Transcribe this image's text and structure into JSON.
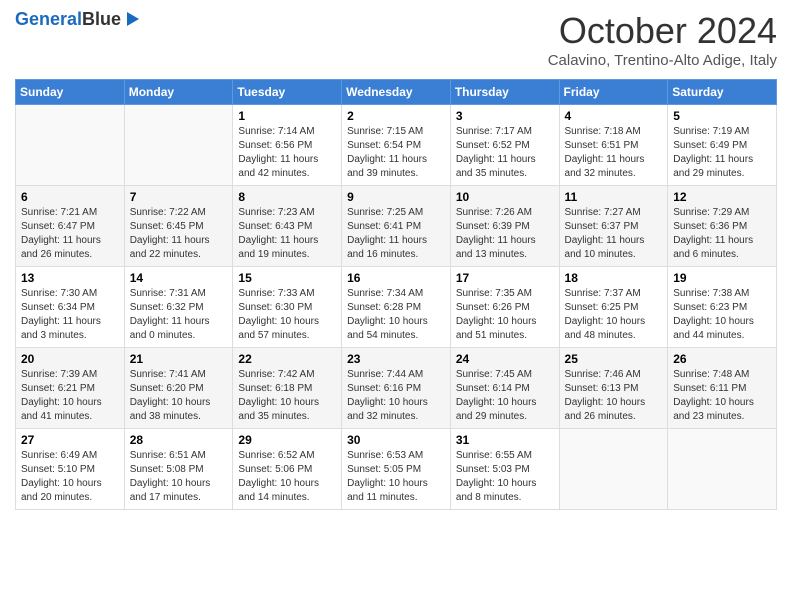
{
  "header": {
    "logo_line1": "General",
    "logo_line2": "Blue",
    "month": "October 2024",
    "location": "Calavino, Trentino-Alto Adige, Italy"
  },
  "days_of_week": [
    "Sunday",
    "Monday",
    "Tuesday",
    "Wednesday",
    "Thursday",
    "Friday",
    "Saturday"
  ],
  "weeks": [
    [
      {
        "day": "",
        "sunrise": "",
        "sunset": "",
        "daylight": ""
      },
      {
        "day": "",
        "sunrise": "",
        "sunset": "",
        "daylight": ""
      },
      {
        "day": "1",
        "sunrise": "Sunrise: 7:14 AM",
        "sunset": "Sunset: 6:56 PM",
        "daylight": "Daylight: 11 hours and 42 minutes."
      },
      {
        "day": "2",
        "sunrise": "Sunrise: 7:15 AM",
        "sunset": "Sunset: 6:54 PM",
        "daylight": "Daylight: 11 hours and 39 minutes."
      },
      {
        "day": "3",
        "sunrise": "Sunrise: 7:17 AM",
        "sunset": "Sunset: 6:52 PM",
        "daylight": "Daylight: 11 hours and 35 minutes."
      },
      {
        "day": "4",
        "sunrise": "Sunrise: 7:18 AM",
        "sunset": "Sunset: 6:51 PM",
        "daylight": "Daylight: 11 hours and 32 minutes."
      },
      {
        "day": "5",
        "sunrise": "Sunrise: 7:19 AM",
        "sunset": "Sunset: 6:49 PM",
        "daylight": "Daylight: 11 hours and 29 minutes."
      }
    ],
    [
      {
        "day": "6",
        "sunrise": "Sunrise: 7:21 AM",
        "sunset": "Sunset: 6:47 PM",
        "daylight": "Daylight: 11 hours and 26 minutes."
      },
      {
        "day": "7",
        "sunrise": "Sunrise: 7:22 AM",
        "sunset": "Sunset: 6:45 PM",
        "daylight": "Daylight: 11 hours and 22 minutes."
      },
      {
        "day": "8",
        "sunrise": "Sunrise: 7:23 AM",
        "sunset": "Sunset: 6:43 PM",
        "daylight": "Daylight: 11 hours and 19 minutes."
      },
      {
        "day": "9",
        "sunrise": "Sunrise: 7:25 AM",
        "sunset": "Sunset: 6:41 PM",
        "daylight": "Daylight: 11 hours and 16 minutes."
      },
      {
        "day": "10",
        "sunrise": "Sunrise: 7:26 AM",
        "sunset": "Sunset: 6:39 PM",
        "daylight": "Daylight: 11 hours and 13 minutes."
      },
      {
        "day": "11",
        "sunrise": "Sunrise: 7:27 AM",
        "sunset": "Sunset: 6:37 PM",
        "daylight": "Daylight: 11 hours and 10 minutes."
      },
      {
        "day": "12",
        "sunrise": "Sunrise: 7:29 AM",
        "sunset": "Sunset: 6:36 PM",
        "daylight": "Daylight: 11 hours and 6 minutes."
      }
    ],
    [
      {
        "day": "13",
        "sunrise": "Sunrise: 7:30 AM",
        "sunset": "Sunset: 6:34 PM",
        "daylight": "Daylight: 11 hours and 3 minutes."
      },
      {
        "day": "14",
        "sunrise": "Sunrise: 7:31 AM",
        "sunset": "Sunset: 6:32 PM",
        "daylight": "Daylight: 11 hours and 0 minutes."
      },
      {
        "day": "15",
        "sunrise": "Sunrise: 7:33 AM",
        "sunset": "Sunset: 6:30 PM",
        "daylight": "Daylight: 10 hours and 57 minutes."
      },
      {
        "day": "16",
        "sunrise": "Sunrise: 7:34 AM",
        "sunset": "Sunset: 6:28 PM",
        "daylight": "Daylight: 10 hours and 54 minutes."
      },
      {
        "day": "17",
        "sunrise": "Sunrise: 7:35 AM",
        "sunset": "Sunset: 6:26 PM",
        "daylight": "Daylight: 10 hours and 51 minutes."
      },
      {
        "day": "18",
        "sunrise": "Sunrise: 7:37 AM",
        "sunset": "Sunset: 6:25 PM",
        "daylight": "Daylight: 10 hours and 48 minutes."
      },
      {
        "day": "19",
        "sunrise": "Sunrise: 7:38 AM",
        "sunset": "Sunset: 6:23 PM",
        "daylight": "Daylight: 10 hours and 44 minutes."
      }
    ],
    [
      {
        "day": "20",
        "sunrise": "Sunrise: 7:39 AM",
        "sunset": "Sunset: 6:21 PM",
        "daylight": "Daylight: 10 hours and 41 minutes."
      },
      {
        "day": "21",
        "sunrise": "Sunrise: 7:41 AM",
        "sunset": "Sunset: 6:20 PM",
        "daylight": "Daylight: 10 hours and 38 minutes."
      },
      {
        "day": "22",
        "sunrise": "Sunrise: 7:42 AM",
        "sunset": "Sunset: 6:18 PM",
        "daylight": "Daylight: 10 hours and 35 minutes."
      },
      {
        "day": "23",
        "sunrise": "Sunrise: 7:44 AM",
        "sunset": "Sunset: 6:16 PM",
        "daylight": "Daylight: 10 hours and 32 minutes."
      },
      {
        "day": "24",
        "sunrise": "Sunrise: 7:45 AM",
        "sunset": "Sunset: 6:14 PM",
        "daylight": "Daylight: 10 hours and 29 minutes."
      },
      {
        "day": "25",
        "sunrise": "Sunrise: 7:46 AM",
        "sunset": "Sunset: 6:13 PM",
        "daylight": "Daylight: 10 hours and 26 minutes."
      },
      {
        "day": "26",
        "sunrise": "Sunrise: 7:48 AM",
        "sunset": "Sunset: 6:11 PM",
        "daylight": "Daylight: 10 hours and 23 minutes."
      }
    ],
    [
      {
        "day": "27",
        "sunrise": "Sunrise: 6:49 AM",
        "sunset": "Sunset: 5:10 PM",
        "daylight": "Daylight: 10 hours and 20 minutes."
      },
      {
        "day": "28",
        "sunrise": "Sunrise: 6:51 AM",
        "sunset": "Sunset: 5:08 PM",
        "daylight": "Daylight: 10 hours and 17 minutes."
      },
      {
        "day": "29",
        "sunrise": "Sunrise: 6:52 AM",
        "sunset": "Sunset: 5:06 PM",
        "daylight": "Daylight: 10 hours and 14 minutes."
      },
      {
        "day": "30",
        "sunrise": "Sunrise: 6:53 AM",
        "sunset": "Sunset: 5:05 PM",
        "daylight": "Daylight: 10 hours and 11 minutes."
      },
      {
        "day": "31",
        "sunrise": "Sunrise: 6:55 AM",
        "sunset": "Sunset: 5:03 PM",
        "daylight": "Daylight: 10 hours and 8 minutes."
      },
      {
        "day": "",
        "sunrise": "",
        "sunset": "",
        "daylight": ""
      },
      {
        "day": "",
        "sunrise": "",
        "sunset": "",
        "daylight": ""
      }
    ]
  ]
}
